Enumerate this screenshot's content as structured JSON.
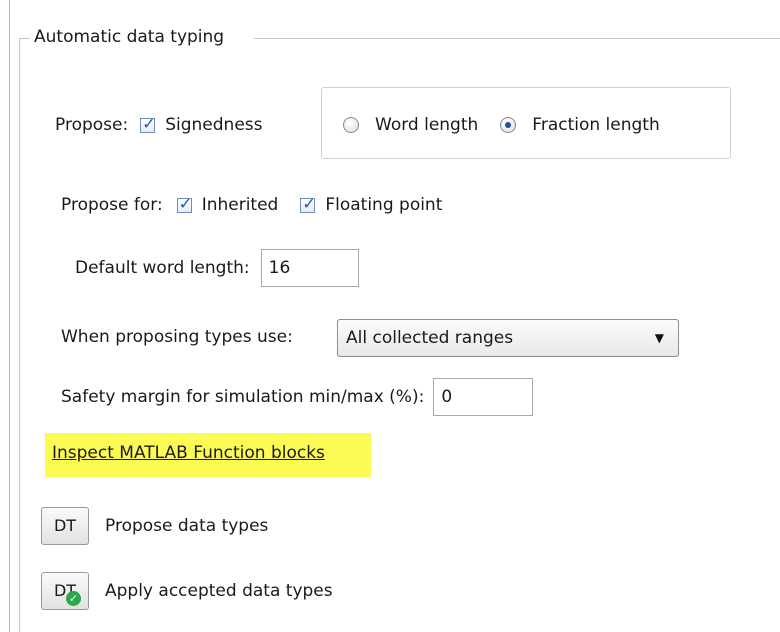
{
  "group": {
    "title": "Automatic data typing"
  },
  "propose": {
    "label": "Propose:",
    "signedness": {
      "label": "Signedness",
      "checked": true
    },
    "word_length": {
      "label": "Word length",
      "selected": false
    },
    "fraction_length": {
      "label": "Fraction length",
      "selected": true
    }
  },
  "propose_for": {
    "label": "Propose for:",
    "inherited": {
      "label": "Inherited",
      "checked": true
    },
    "floating_point": {
      "label": "Floating point",
      "checked": true
    }
  },
  "default_word_length": {
    "label": "Default word length:",
    "value": "16"
  },
  "when_proposing": {
    "label": "When proposing types use:",
    "value": "All collected ranges"
  },
  "safety_margin": {
    "label": "Safety margin for simulation min/max (%):",
    "value": "0"
  },
  "inspect_link": {
    "label": "Inspect MATLAB Function blocks"
  },
  "propose_dt": {
    "button": "DT",
    "label": "Propose data types"
  },
  "apply_dt": {
    "button": "DT",
    "label": "Apply accepted data types"
  },
  "colors": {
    "accent": "#2b56a8",
    "link_highlight": "#fbfb54",
    "ok_green": "#2aa84a"
  }
}
